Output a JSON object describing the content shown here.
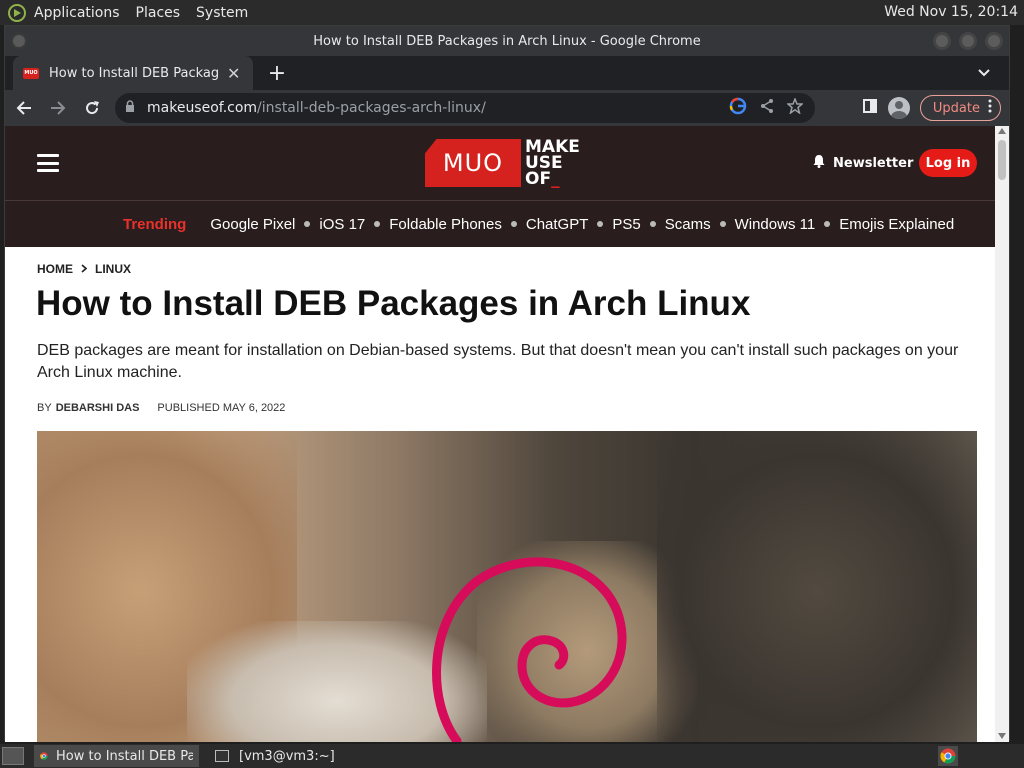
{
  "top_panel": {
    "menus": [
      "Applications",
      "Places",
      "System"
    ],
    "clock": "Wed Nov 15, 20:14"
  },
  "window": {
    "title": "How to Install DEB Packages in Arch Linux - Google Chrome"
  },
  "tab": {
    "title": "How to Install DEB Packages in Arch Linux",
    "favicon_text": "MUO"
  },
  "address": {
    "host": "makeuseof.com",
    "path": "/install-deb-packages-arch-linux/"
  },
  "toolbar": {
    "update_label": "Update"
  },
  "site": {
    "logo_mark": "MUO",
    "logo_line1": "MAKE",
    "logo_line2": "USE",
    "logo_line3": "OF",
    "newsletter_label": "Newsletter",
    "login_label": "Log in",
    "trending_label": "Trending",
    "trending_items": [
      "Google Pixel",
      "iOS 17",
      "Foldable Phones",
      "ChatGPT",
      "PS5",
      "Scams",
      "Windows 11",
      "Emojis Explained"
    ]
  },
  "article": {
    "breadcrumb": [
      "HOME",
      "LINUX"
    ],
    "title": "How to Install DEB Packages in Arch Linux",
    "subtitle": "DEB packages are meant for installation on Debian-based systems. But that doesn't mean you can't install such packages on your Arch Linux machine.",
    "by_label": "BY",
    "author": "DEBARSHI DAS",
    "published": "PUBLISHED MAY 6, 2022"
  },
  "taskbar": {
    "tasks": [
      "How to Install DEB Packages in Arch Linux",
      "[vm3@vm3:~]"
    ]
  },
  "colors": {
    "brand_red": "#d6221e",
    "header_bg": "#2a1d1d",
    "chrome_dark": "#202124"
  }
}
